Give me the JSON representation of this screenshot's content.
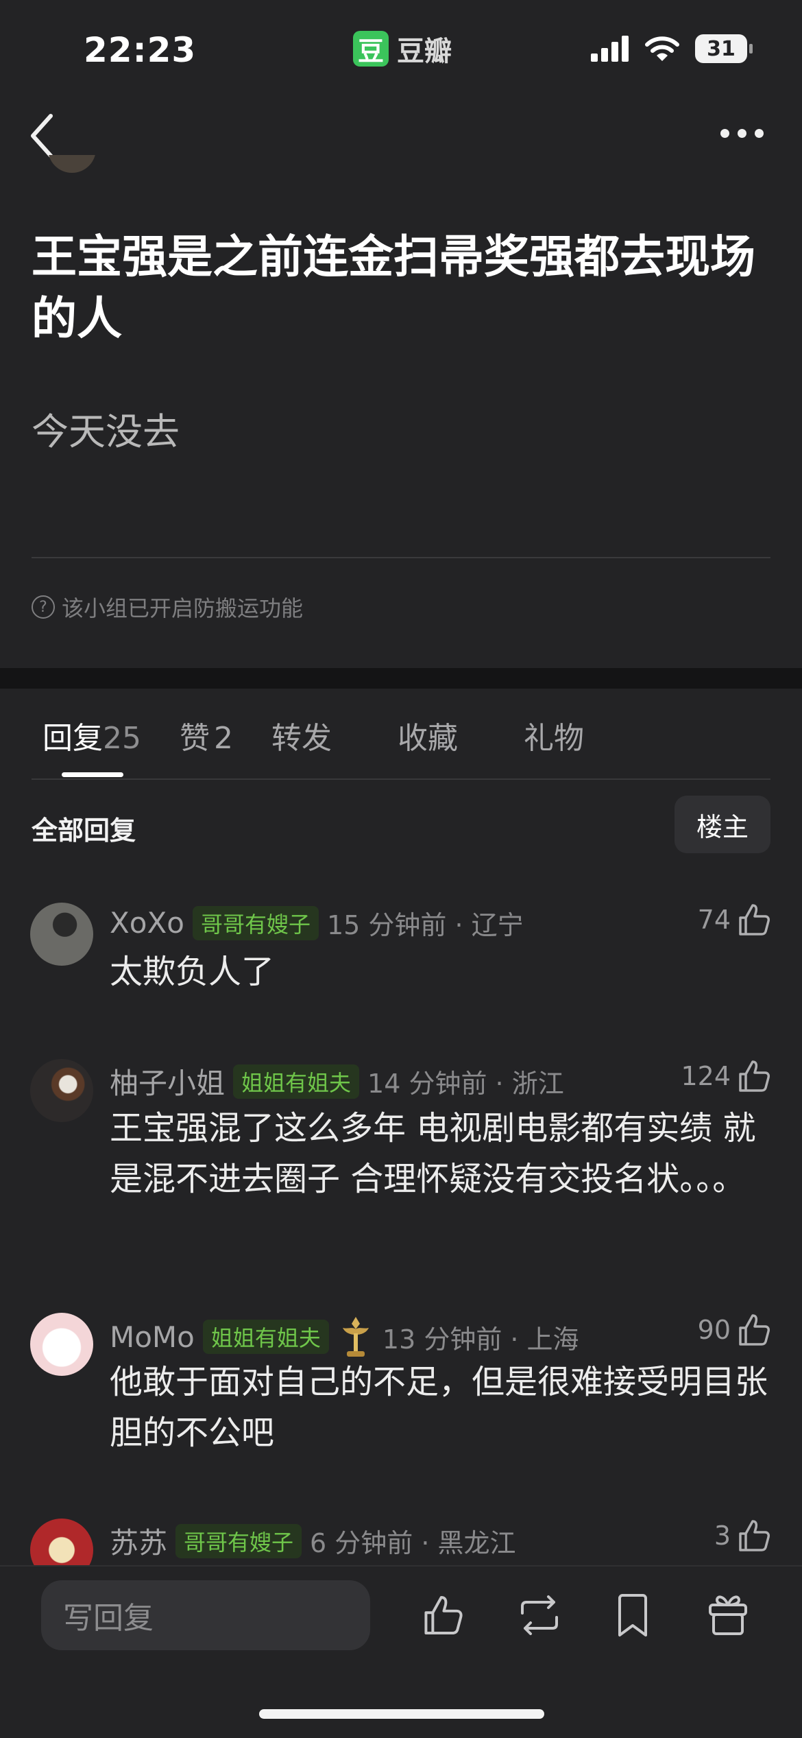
{
  "status_bar": {
    "time": "22:23",
    "battery": "31"
  },
  "app": {
    "logo_char": "豆",
    "name": "豆瓣"
  },
  "post": {
    "title": "王宝强是之前连金扫帚奖强都去现场的人",
    "body": "今天没去",
    "notice": "该小组已开启防搬运功能"
  },
  "tabs": [
    {
      "label": "回复",
      "count": "25"
    },
    {
      "label": "赞",
      "count": "2"
    },
    {
      "label": "转发"
    },
    {
      "label": "收藏"
    },
    {
      "label": "礼物"
    }
  ],
  "replies_header": {
    "title": "全部回复",
    "op_filter": "楼主"
  },
  "comments": [
    {
      "name": "XoXo",
      "tag": "哥哥有嫂子",
      "time": "15 分钟前 · 辽宁",
      "likes": "74",
      "text": "太欺负人了"
    },
    {
      "name": "柚子小姐",
      "tag": "姐姐有姐夫",
      "time": "14 分钟前 · 浙江",
      "likes": "124",
      "text": "王宝强混了这么多年 电视剧电影都有实绩 就是混不进去圈子  合理怀疑没有交投名状。。。"
    },
    {
      "name": "MoMo",
      "tag": "姐姐有姐夫",
      "time": "13 分钟前 · 上海",
      "likes": "90",
      "text": "他敢于面对自己的不足，但是很难接受明目张胆的不公吧"
    },
    {
      "name": "苏苏",
      "tag": "哥哥有嫂子",
      "time": "6 分钟前 · 黑龙江",
      "likes": "3",
      "text": ""
    }
  ],
  "bottom_bar": {
    "reply_placeholder": "写回复"
  },
  "colors": {
    "background": "#232325",
    "tag_green": "#6fc64a",
    "brand_green": "#3bc45b"
  }
}
